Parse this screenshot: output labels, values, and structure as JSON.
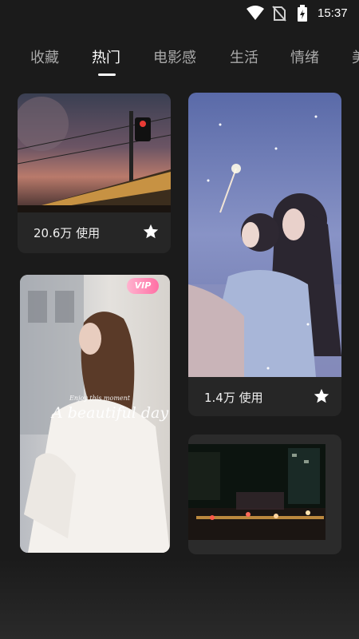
{
  "status_bar": {
    "time": "15:37",
    "icons": [
      "wifi-icon",
      "no-sim-icon",
      "battery-charging-icon"
    ]
  },
  "tabs": [
    {
      "label": "收藏"
    },
    {
      "label": "热门",
      "active": true
    },
    {
      "label": "电影感"
    },
    {
      "label": "生活"
    },
    {
      "label": "情绪"
    },
    {
      "label": "美"
    }
  ],
  "cards": [
    {
      "usage": "20.6万 使用",
      "favorite_icon": "star-icon",
      "image": "sunset train with traffic signal"
    },
    {
      "usage": "1.4万 使用",
      "favorite_icon": "star-icon",
      "image": "two girls with sparklers"
    },
    {
      "badge": "VIP",
      "overlay_text_small": "Enjoy this moment",
      "overlay_text_large": "A beautiful day",
      "image": "woman in white by window"
    },
    {
      "image": "city street at night"
    }
  ],
  "colors": {
    "background": "#1b1b1b",
    "card": "#262626",
    "vip_badge": "#ff6fa4"
  }
}
